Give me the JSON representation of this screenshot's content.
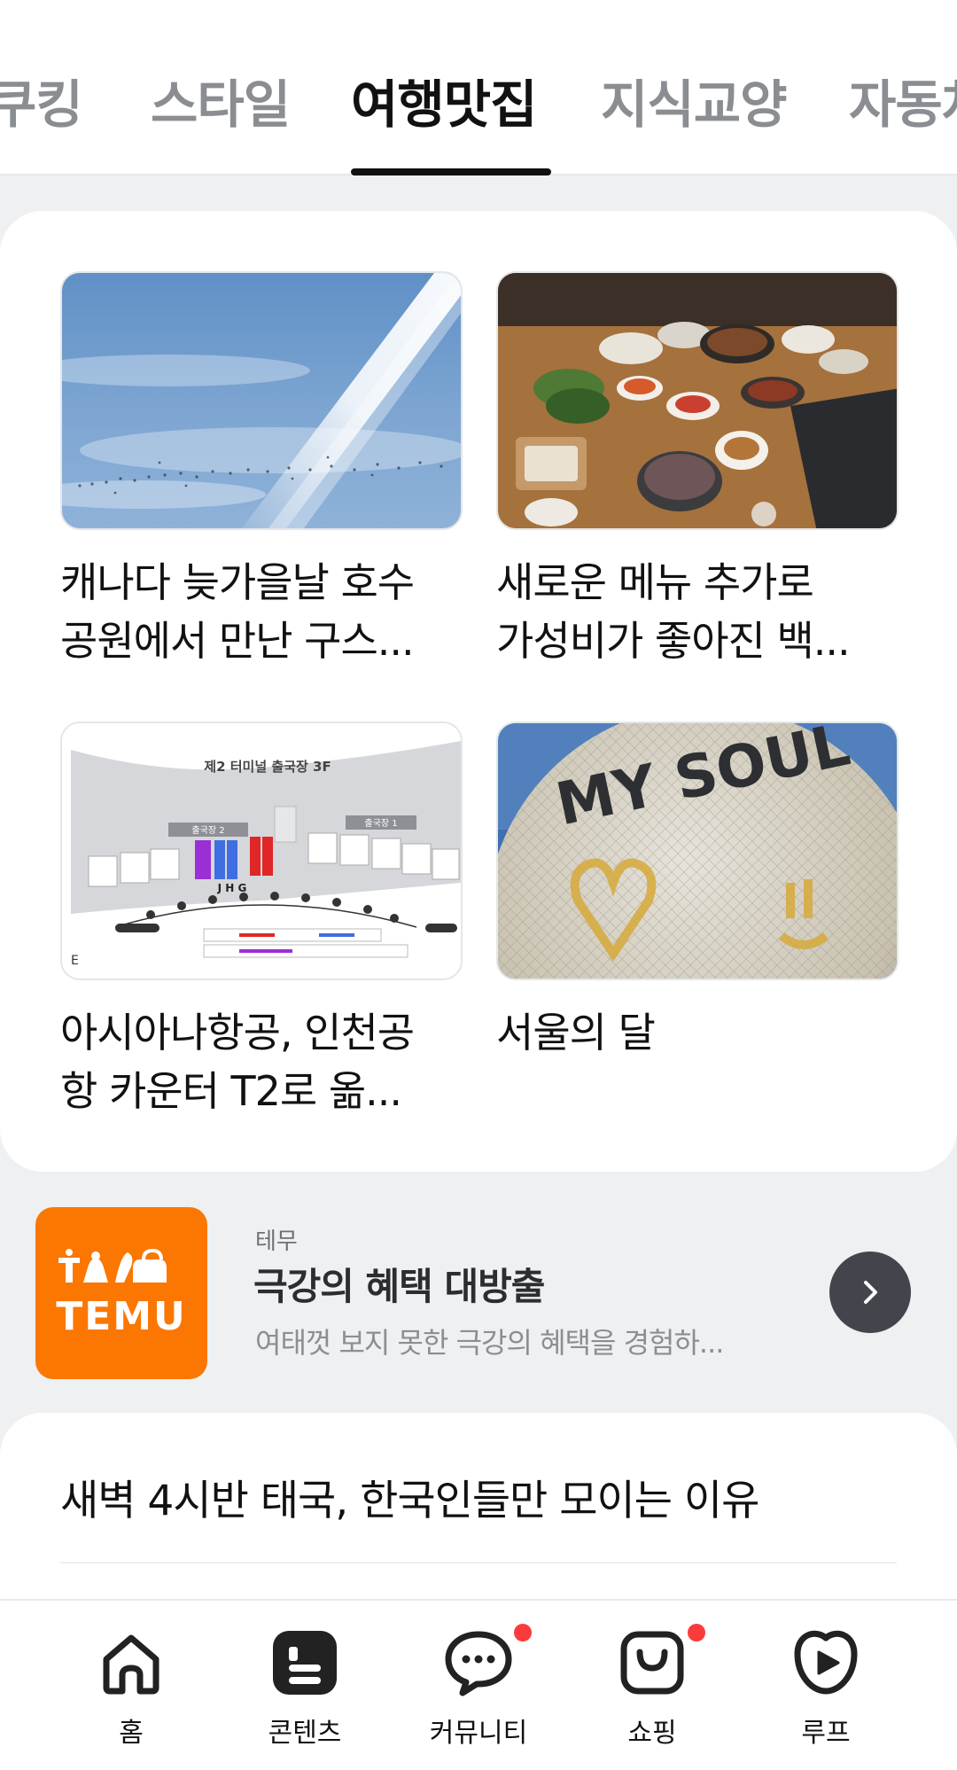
{
  "tabs": {
    "items": [
      {
        "label": "쿠킹"
      },
      {
        "label": "스타일"
      },
      {
        "label": "여행맛집"
      },
      {
        "label": "지식교양"
      },
      {
        "label": "자동차"
      }
    ],
    "active_index": 2
  },
  "feed": {
    "tiles": [
      {
        "line1": "캐나다 늦가을날 호수",
        "line2": "공원에서 만난 구스...",
        "image": "sky-contrail-geese-photo"
      },
      {
        "line1": "새로운 메뉴 추가로",
        "line2": "가성비가 좋아진 백...",
        "image": "korean-table-meal-photo"
      },
      {
        "line1": "아시아나항공, 인천공",
        "line2": "항 카운터 T2로 옮...",
        "image": "terminal-2-departure-map",
        "map": {
          "title": "제2 터미널 출국장 3F",
          "zone_left": "출국장 2",
          "zone_right": "출국장 1",
          "letters": "J  H  G",
          "edge": "E"
        }
      },
      {
        "line1": "서울의 달",
        "line2": "",
        "image": "balloon-my-soul-photo",
        "balloon_text": "MY SOUL"
      }
    ]
  },
  "ad": {
    "source": "테무",
    "title": "극강의 혜택 대방출",
    "description": "여태껏 보지 못한 극강의 혜택을 경험하...",
    "logo_text": "TEMU",
    "logo_color": "#fb7701"
  },
  "article": {
    "title": "새벽 4시반 태국, 한국인들만 모이는 이유"
  },
  "bottom_nav": {
    "items": [
      {
        "label": "홈",
        "icon": "home-icon"
      },
      {
        "label": "콘텐츠",
        "icon": "contents-icon"
      },
      {
        "label": "커뮤니티",
        "icon": "chat-bubble-icon",
        "badge": true
      },
      {
        "label": "쇼핑",
        "icon": "shopping-bag-icon",
        "badge": true
      },
      {
        "label": "루프",
        "icon": "loop-play-icon"
      }
    ],
    "badge_color": "#fb3b3b"
  }
}
